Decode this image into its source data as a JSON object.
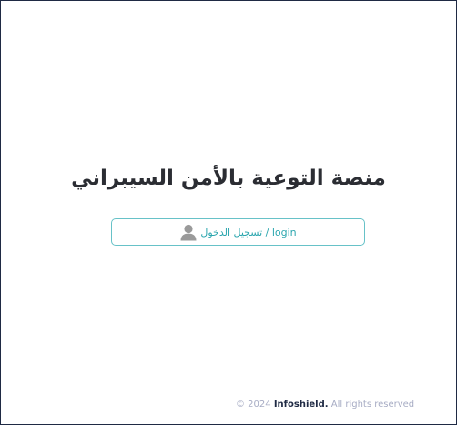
{
  "page": {
    "title": "منصة التوعية بالأمن السيبراني"
  },
  "login": {
    "label": "تسجيل الدخول / login",
    "icon": "user-avatar-icon"
  },
  "footer": {
    "copyright": "© 2024",
    "brand": "Infoshield.",
    "rights": "All rights reserved"
  },
  "colors": {
    "accent": "#2ba6ae",
    "border": "#67c2c8",
    "title": "#2b2d33",
    "footer_text": "#a7acc4",
    "footer_brand": "#1f2a44"
  }
}
